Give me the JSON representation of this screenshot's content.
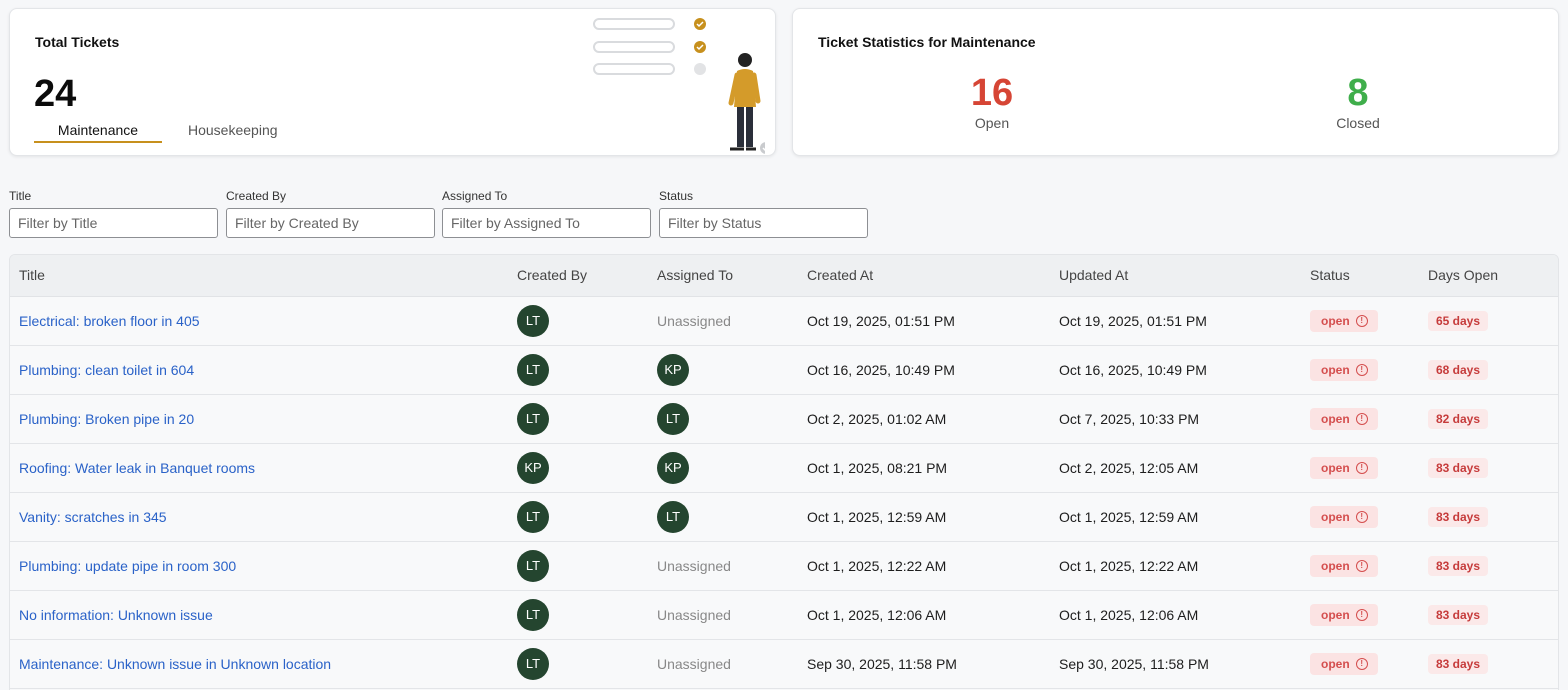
{
  "summary": {
    "title": "Total Tickets",
    "total": "24",
    "tabs": [
      {
        "label": "Maintenance",
        "active": true
      },
      {
        "label": "Housekeeping",
        "active": false
      }
    ]
  },
  "stats": {
    "title": "Ticket Statistics for Maintenance",
    "open_count": "16",
    "open_label": "Open",
    "closed_count": "8",
    "closed_label": "Closed",
    "open_color": "#d64535",
    "closed_color": "#3fae4b"
  },
  "filters": [
    {
      "label": "Title",
      "placeholder": "Filter by Title",
      "value": ""
    },
    {
      "label": "Created By",
      "placeholder": "Filter by Created By",
      "value": ""
    },
    {
      "label": "Assigned To",
      "placeholder": "Filter by Assigned To",
      "value": ""
    },
    {
      "label": "Status",
      "placeholder": "Filter by Status",
      "value": ""
    }
  ],
  "table": {
    "columns": [
      "Title",
      "Created By",
      "Assigned To",
      "Created At",
      "Updated At",
      "Status",
      "Days Open"
    ],
    "rows": [
      {
        "title": "Electrical: broken floor in 405",
        "created_by": "LT",
        "assigned_to": "",
        "created_at": "Oct 19, 2025, 01:51 PM",
        "updated_at": "Oct 19, 2025, 01:51 PM",
        "status": "open",
        "days_open": "65 days"
      },
      {
        "title": "Plumbing: clean toilet in 604",
        "created_by": "LT",
        "assigned_to": "KP",
        "created_at": "Oct 16, 2025, 10:49 PM",
        "updated_at": "Oct 16, 2025, 10:49 PM",
        "status": "open",
        "days_open": "68 days"
      },
      {
        "title": "Plumbing: Broken pipe in 20",
        "created_by": "LT",
        "assigned_to": "LT",
        "created_at": "Oct 2, 2025, 01:02 AM",
        "updated_at": "Oct 7, 2025, 10:33 PM",
        "status": "open",
        "days_open": "82 days"
      },
      {
        "title": "Roofing: Water leak in Banquet rooms",
        "created_by": "KP",
        "assigned_to": "KP",
        "created_at": "Oct 1, 2025, 08:21 PM",
        "updated_at": "Oct 2, 2025, 12:05 AM",
        "status": "open",
        "days_open": "83 days"
      },
      {
        "title": "Vanity: scratches in 345",
        "created_by": "LT",
        "assigned_to": "LT",
        "created_at": "Oct 1, 2025, 12:59 AM",
        "updated_at": "Oct 1, 2025, 12:59 AM",
        "status": "open",
        "days_open": "83 days"
      },
      {
        "title": "Plumbing: update pipe in room 300",
        "created_by": "LT",
        "assigned_to": "",
        "created_at": "Oct 1, 2025, 12:22 AM",
        "updated_at": "Oct 1, 2025, 12:22 AM",
        "status": "open",
        "days_open": "83 days"
      },
      {
        "title": "No information: Unknown issue",
        "created_by": "LT",
        "assigned_to": "",
        "created_at": "Oct 1, 2025, 12:06 AM",
        "updated_at": "Oct 1, 2025, 12:06 AM",
        "status": "open",
        "days_open": "83 days"
      },
      {
        "title": "Maintenance: Unknown issue in Unknown location",
        "created_by": "LT",
        "assigned_to": "",
        "created_at": "Sep 30, 2025, 11:58 PM",
        "updated_at": "Sep 30, 2025, 11:58 PM",
        "status": "open",
        "days_open": "83 days"
      }
    ],
    "unassigned_label": "Unassigned"
  },
  "colors": {
    "accent": "#c7901d",
    "link": "#2a62c8",
    "avatar": "#24452f",
    "status_open_bg": "#fbe3e3",
    "status_open_text": "#d44e4e"
  },
  "icons": {
    "illustration": "person-checklist-illustration",
    "status": "info-circle-icon"
  }
}
